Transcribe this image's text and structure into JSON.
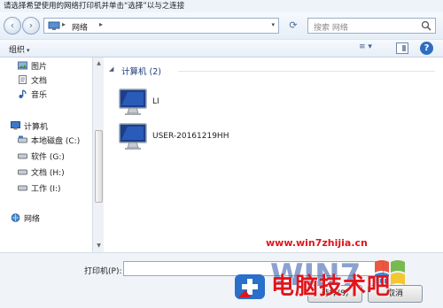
{
  "window": {
    "title": "请选择希望使用的网络打印机并单击“选择”以与之连接"
  },
  "nav": {
    "back_icon": "back-arrow-icon",
    "forward_icon": "forward-arrow-icon",
    "address_sep": "▸",
    "address_item": "网络",
    "address_sep2": "▸",
    "address_dropdown": "▾",
    "refresh_icon": "refresh-icon",
    "search_placeholder": "搜索 网络"
  },
  "toolbar": {
    "organize": "组织",
    "dropdown": "▾",
    "view_glyph": "≡ ▾",
    "help": "?"
  },
  "sidebar": {
    "items": [
      {
        "label": "图片",
        "icon": "pictures-icon"
      },
      {
        "label": "文档",
        "icon": "documents-icon"
      },
      {
        "label": "音乐",
        "icon": "music-icon"
      },
      {
        "label": "计算机",
        "icon": "computer-icon"
      },
      {
        "label": "本地磁盘 (C:)",
        "icon": "drive-icon"
      },
      {
        "label": "软件 (G:)",
        "icon": "drive-icon"
      },
      {
        "label": "文档 (H:)",
        "icon": "drive-icon"
      },
      {
        "label": "工作 (I:)",
        "icon": "drive-icon"
      },
      {
        "label": "网络",
        "icon": "network-icon"
      }
    ]
  },
  "content": {
    "group_arrow": "◢",
    "group_title": "计算机 (2)",
    "computers": [
      {
        "name": "LI",
        "icon": "monitor-icon"
      },
      {
        "name": "USER-20161219HH",
        "icon": "monitor-icon"
      }
    ]
  },
  "bottom": {
    "printer_label": "打印机(P):",
    "printer_value": "",
    "select_button": "选择(S)",
    "cancel_button": "取消"
  },
  "watermark": {
    "url": "www.win7zhijia.cn",
    "text": "电脑技术吧"
  },
  "colors": {
    "accent": "#1e3d7b",
    "watermark_red": "#e0151b",
    "help_blue": "#2f6dc0"
  }
}
